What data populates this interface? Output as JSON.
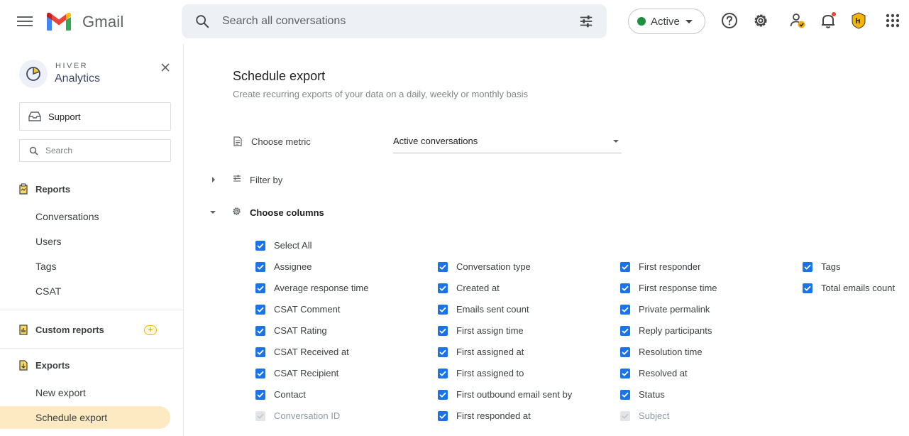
{
  "app": {
    "name": "Gmail"
  },
  "search": {
    "placeholder": "Search all conversations"
  },
  "status": {
    "label": "Active",
    "color": "#1e8e3e"
  },
  "top_icons": [
    "help-icon",
    "settings-icon",
    "contacts-status-icon",
    "notifications-bell-icon",
    "hiver-extension-icon",
    "apps-grid-icon"
  ],
  "sidebar": {
    "brand_small": "HIVER",
    "brand_big": "Analytics",
    "inbox_label": "Support",
    "search_placeholder": "Search",
    "sections": {
      "reports": "Reports",
      "custom_reports": "Custom reports",
      "exports": "Exports"
    },
    "report_items": [
      "Conversations",
      "Users",
      "Tags",
      "CSAT"
    ],
    "export_items": [
      "New export",
      "Schedule export"
    ],
    "plus_label": "+",
    "active_item": "Schedule export"
  },
  "main": {
    "title": "Schedule export",
    "subtitle": "Create recurring exports of your data on a daily, weekly or monthly basis",
    "choose_metric_label": "Choose metric",
    "metric_value": "Active conversations",
    "filter_label": "Filter by",
    "columns_label": "Choose columns",
    "select_all": "Select All",
    "columns": [
      [
        "Assignee",
        "Average response time",
        "CSAT Comment",
        "CSAT Rating",
        "CSAT Received at",
        "CSAT Recipient",
        "Contact",
        "Conversation ID"
      ],
      [
        "Conversation type",
        "Created at",
        "Emails sent count",
        "First assign time",
        "First assigned at",
        "First assigned to",
        "First outbound email sent by",
        "First responded at"
      ],
      [
        "First responder",
        "First response time",
        "Private permalink",
        "Reply participants",
        "Resolution time",
        "Resolved at",
        "Status",
        "Subject"
      ],
      [
        "Tags",
        "Total emails count"
      ]
    ],
    "disabled_columns": [
      "Conversation ID",
      "Subject"
    ],
    "checkbox_color": "#1a73e8"
  }
}
